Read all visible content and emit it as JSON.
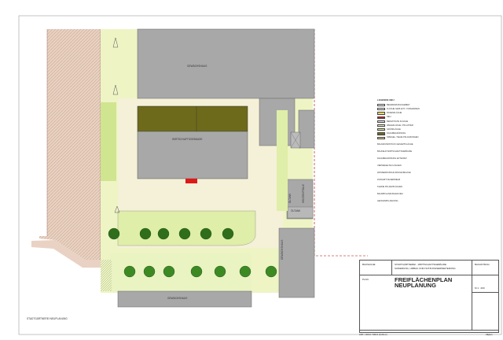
{
  "labels": {
    "gewaechshaus_top": "GEWÄCHSHAUS",
    "gewaechshaus_bottom": "GEWÄCHSHAUS",
    "gewaechshaus_right": "GEWÄCHSHAUS",
    "wirtschaftsgebaeude": "WIRTSCHAFTSGEBÄUDE",
    "oeltank_vertical": "ÖLTANK",
    "heizzentrale": "HEIZZENTRALE",
    "oeltank_horizontal": "ÖLTANK",
    "stadtgaertnerei": "STADTGÄRTNEREI  NEUPLANUNG"
  },
  "legend": {
    "title": "LEGENDE NEU",
    "items": [
      {
        "swatch": "#ffffff",
        "text": "BEGRENZUNGSGEBIET"
      },
      {
        "swatch": "#ffffff",
        "text": "FLÄCHE GEPLANT / VORHANDEN"
      },
      {
        "swatch": "#e9d86a",
        "text": "RASENFLÄCHE"
      },
      {
        "swatch": "#e01818",
        "text": "NEU"
      },
      {
        "swatch": "#e8eaf0",
        "text": "BEFESTIGTE FLÄCHE"
      },
      {
        "swatch": "#f3f0c8",
        "text": "WEGEFLÄCHE / PFLASTER"
      },
      {
        "swatch": "#d9ec9a",
        "text": "GRÜNFLÄCHE"
      },
      {
        "swatch": "#6e6a1c",
        "text": "DACHBEGRÜNUNG"
      },
      {
        "swatch": "#e0c890",
        "text": "SPIEGEL / NEUE PFLANZUNGEN"
      }
    ],
    "notes": [
      "BAUGRUNDSTÜCK GESAMTFLÄCHE",
      "BAUFELD WIRTSCHAFTSGEBÄUDE",
      "DACHBEGRÜNUNG EXTENSIV",
      "VERSIEGELTE FLÄCHEN",
      "WASSERDURCHLÄSSIGE BELÄGE",
      "ZUFAHRT FEUERWEHR",
      "KLEINE PFLANZFLÄCHEN",
      "BAUMPFLANZUNGEN NEU",
      "HECKENPFLANZUNG"
    ]
  },
  "title_block": {
    "cell1": "BAUSACHE",
    "cell2_line1": "STADTGÄRTNEREI - WIRTSCHAFTSGEBÄUDE",
    "cell2_line2": "SANIERUNG, UMBAU UND NUTZUNGSERWEITERUNG",
    "cell3": "BAUANTRAG",
    "plan_label": "PLAN",
    "plan_title_1": "FREIFLÄCHENPLAN",
    "plan_title_2": "NEUPLANUNG",
    "scale": "M 1 : 200",
    "footer": "H/B = 400.0 / 600.0 (0.24m²)",
    "footer_right": "Allplan"
  }
}
